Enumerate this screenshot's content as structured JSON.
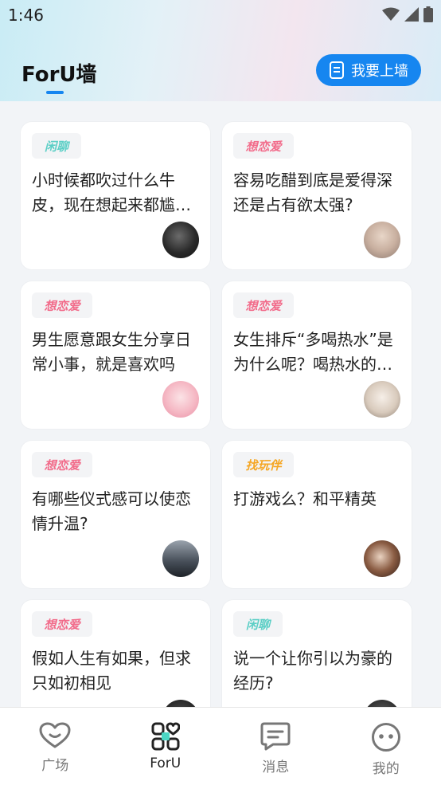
{
  "status_bar": {
    "time": "1:46"
  },
  "header": {
    "title": "ForU墙",
    "post_button_label": "我要上墙"
  },
  "cards": [
    {
      "tag": "闲聊",
      "tag_color": "#5ccfc6",
      "text": "小时候都吹过什么牛皮，现在想起来都尴尬的",
      "avatar": "avatar-dark-portrait"
    },
    {
      "tag": "想恋爱",
      "tag_color": "#f26b8a",
      "text": "容易吃醋到底是爱得深还是占有欲太强?",
      "avatar": "avatar-blonde-girl"
    },
    {
      "tag": "想恋爱",
      "tag_color": "#f26b8a",
      "text": "男生愿意跟女生分享日常小事，就是喜欢吗",
      "avatar": "avatar-pink-cartoon"
    },
    {
      "tag": "想恋爱",
      "tag_color": "#f26b8a",
      "text": "女生排斥“多喝热水”是为什么呢？喝热水的好处",
      "avatar": "avatar-child-photo"
    },
    {
      "tag": "想恋爱",
      "tag_color": "#f26b8a",
      "text": "有哪些仪式感可以使恋情升温?",
      "avatar": "avatar-silhouette-sea"
    },
    {
      "tag": "找玩伴",
      "tag_color": "#f5a623",
      "text": "打游戏么？和平精英",
      "avatar": "avatar-anime-girl"
    },
    {
      "tag": "想恋爱",
      "tag_color": "#f26b8a",
      "text": "假如人生有如果，但求只如初相见",
      "avatar": "avatar-dark"
    },
    {
      "tag": "闲聊",
      "tag_color": "#5ccfc6",
      "text": "说一个让你引以为豪的经历?",
      "avatar": "avatar-dark-2"
    }
  ],
  "bottom_nav": [
    {
      "label": "广场",
      "icon": "heart-icon"
    },
    {
      "label": "ForU",
      "icon": "foru-grid-icon"
    },
    {
      "label": "消息",
      "icon": "message-icon"
    },
    {
      "label": "我的",
      "icon": "face-icon"
    }
  ],
  "colors": {
    "accent": "#1686f0"
  }
}
